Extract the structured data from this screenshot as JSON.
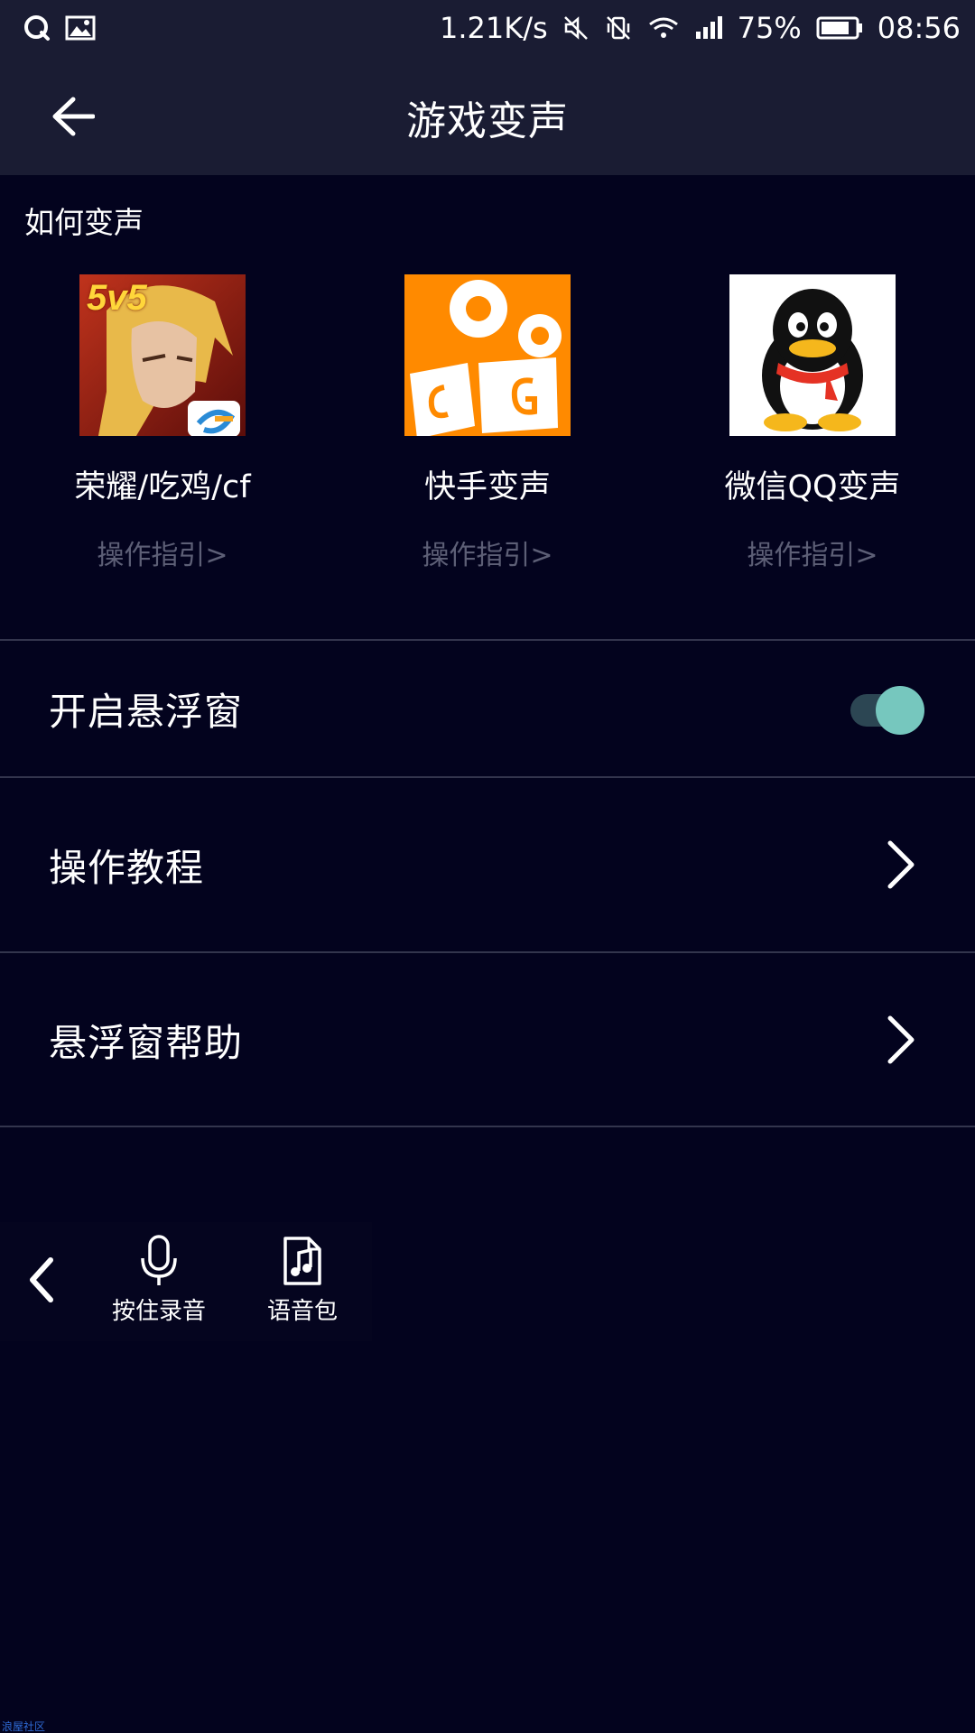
{
  "status_bar": {
    "network_speed": "1.21K/s",
    "battery": "75%",
    "time": "08:56"
  },
  "header": {
    "title": "游戏变声"
  },
  "how_to": {
    "label": "如何变声",
    "apps": [
      {
        "name": "荣耀/吃鸡/cf",
        "guide": "操作指引>",
        "badge": "5v5"
      },
      {
        "name": "快手变声",
        "guide": "操作指引>"
      },
      {
        "name": "微信QQ变声",
        "guide": "操作指引>"
      }
    ]
  },
  "settings": {
    "floating_window": {
      "label": "开启悬浮窗",
      "enabled": true
    },
    "tutorial": {
      "label": "操作教程"
    },
    "floating_help": {
      "label": "悬浮窗帮助"
    }
  },
  "float_bar": {
    "record_label": "按住录音",
    "voice_pack_label": "语音包"
  },
  "watermark": "浪屋社区",
  "colors": {
    "background": "#03031e",
    "header": "#1a1c33",
    "toggle_knob": "#76c7be",
    "toggle_track": "#2c4653",
    "guide_text": "#5d5f76",
    "kuaishou_orange": "#ff8a00"
  },
  "icons": [
    "qq-icon",
    "image-icon",
    "mute-icon",
    "vibrate-off-icon",
    "wifi-icon",
    "signal-icon",
    "battery-icon",
    "back-arrow-icon",
    "chevron-right-icon",
    "microphone-icon",
    "music-file-icon",
    "chevron-left-icon"
  ]
}
